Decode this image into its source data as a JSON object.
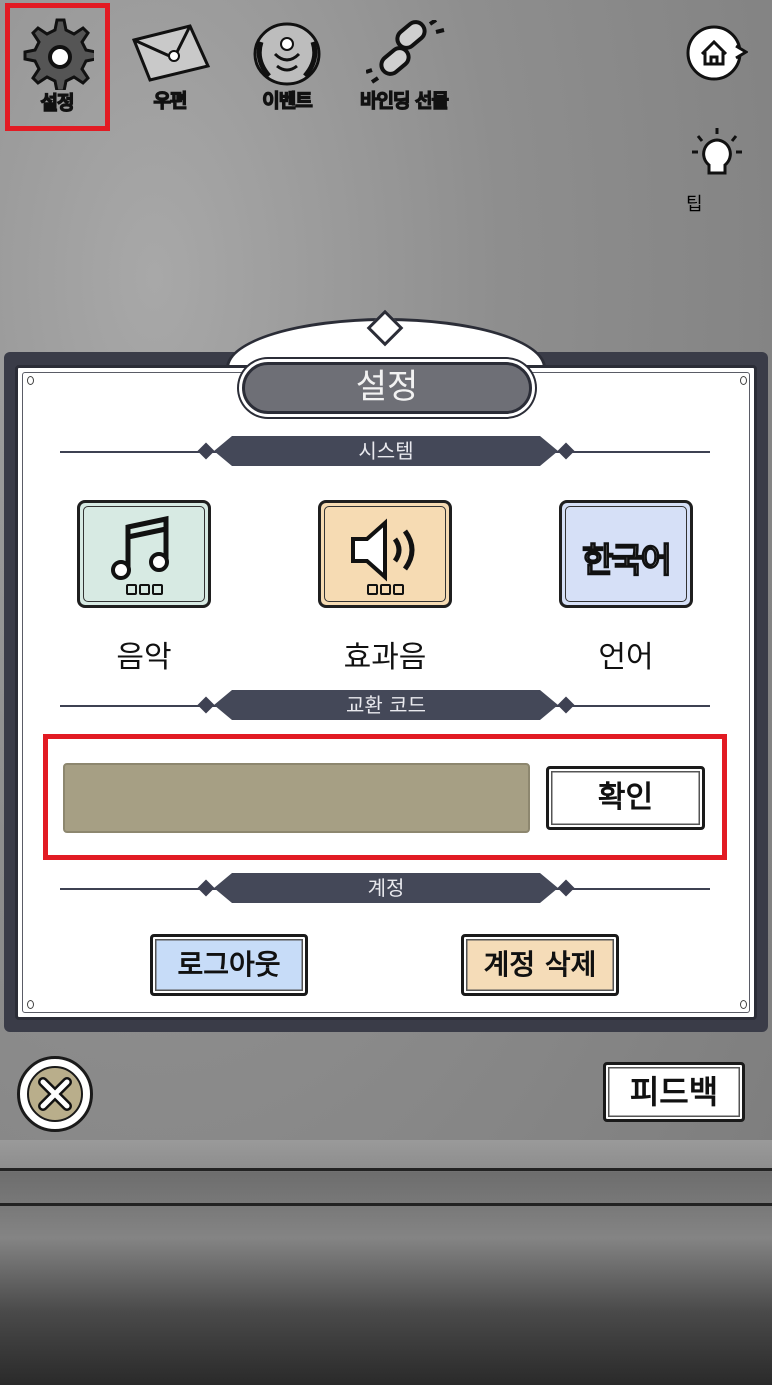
{
  "top_nav": {
    "settings": "설정",
    "mail": "우편",
    "event": "이벤트",
    "bind_gift": "바인딩 선물",
    "tips": "팁"
  },
  "dialog": {
    "title": "설정",
    "system_header": "시스템",
    "music_label": "음악",
    "sfx_label": "효과음",
    "language_label": "언어",
    "language_value": "한국어",
    "redeem_header": "교환 코드",
    "redeem_input_value": "",
    "confirm_label": "확인",
    "account_header": "계정",
    "logout_label": "로그아웃",
    "delete_account_label": "계정 삭제"
  },
  "feedback_label": "피드백",
  "colors": {
    "highlight": "#e21b23",
    "music_tile": "#d7eae3",
    "sfx_tile": "#f6dbb3",
    "language_tile": "#d6e0f7",
    "logout_button": "#c7dcf8",
    "delete_button": "#f5dcb8",
    "code_input": "#a69f84",
    "section_band": "#444858"
  }
}
